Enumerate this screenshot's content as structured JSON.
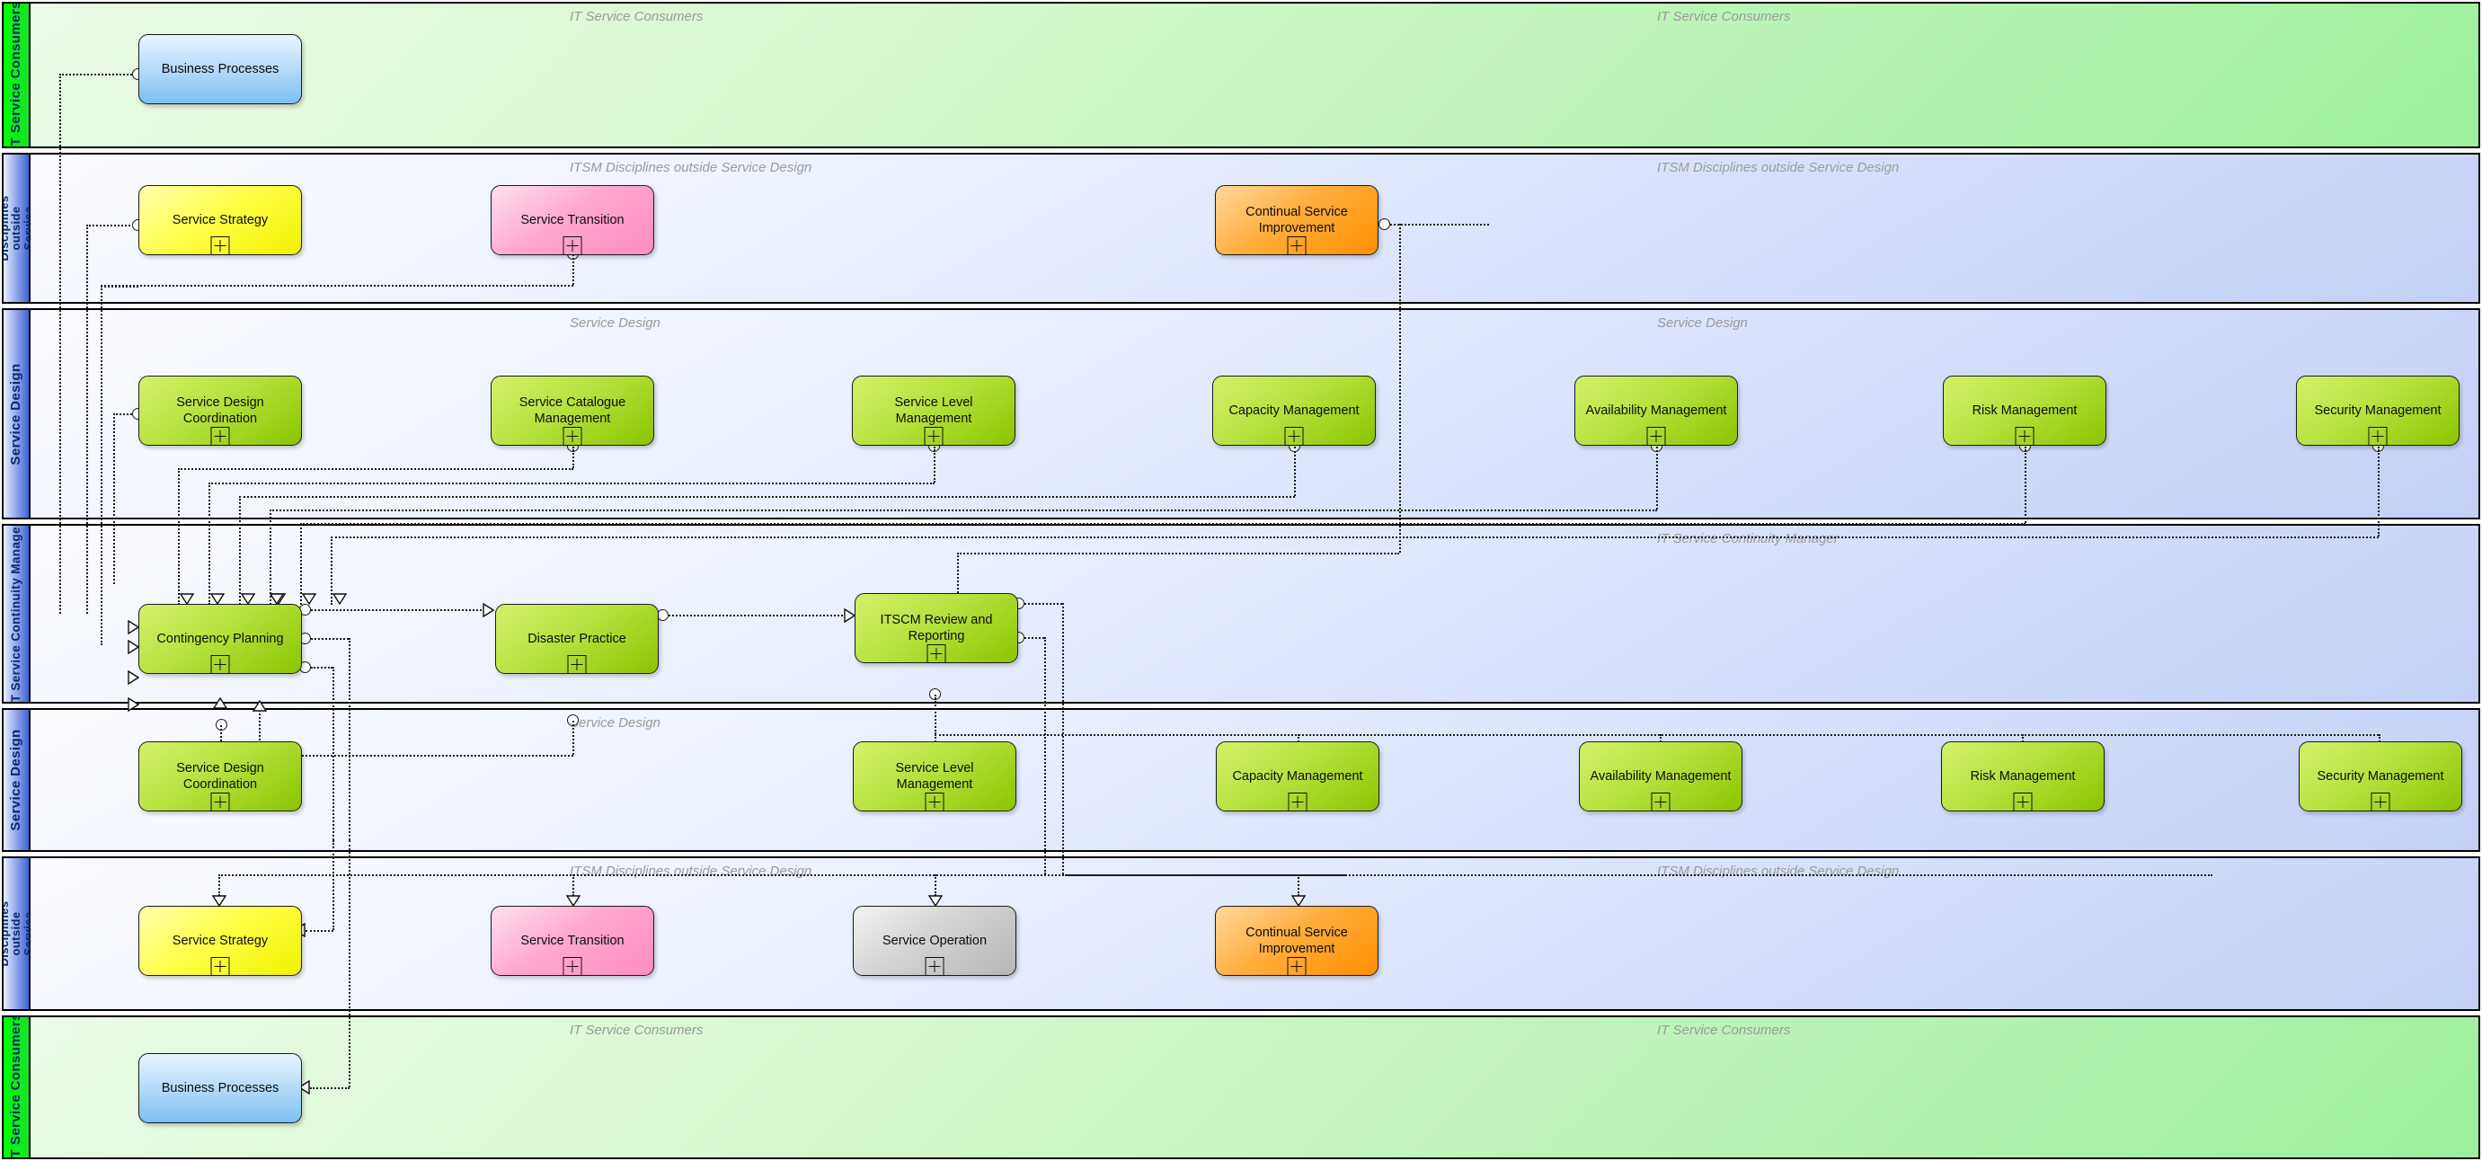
{
  "diagram": {
    "type": "BPMN swimlane collaboration diagram",
    "subject": "IT Service Continuity Management (ITSCM) process interfaces"
  },
  "lanes": [
    {
      "id": "lane1",
      "label": "IT Service Consumers",
      "title_left": "IT Service Consumers",
      "title_right": "IT Service Consumers",
      "palette": "green"
    },
    {
      "id": "lane2",
      "label": "ITSM Disciplines outside\nService Design",
      "title_left": "ITSM Disciplines outside Service Design",
      "title_right": "ITSM Disciplines outside Service Design",
      "palette": "blue"
    },
    {
      "id": "lane3",
      "label": "Service Design",
      "title_left": "Service Design",
      "title_right": "Service Design",
      "palette": "blue"
    },
    {
      "id": "lane4",
      "label": "IT Service Continuity Manager",
      "title_left": "",
      "title_right": "IT Service Continuity Manager",
      "palette": "blue"
    },
    {
      "id": "lane5",
      "label": "Service Design",
      "title_left": "Service Design",
      "title_right": "",
      "palette": "blue"
    },
    {
      "id": "lane6",
      "label": "ITSM Disciplines outside\nService Design",
      "title_left": "ITSM Disciplines outside Service Design",
      "title_right": "ITSM Disciplines outside Service Design",
      "palette": "blue"
    },
    {
      "id": "lane7",
      "label": "IT Service Consumers",
      "title_left": "IT Service Consumers",
      "title_right": "IT Service Consumers",
      "palette": "green"
    }
  ],
  "nodes": {
    "business_processes_top": {
      "label": "Business Processes",
      "color": "#7cc0f2",
      "marker": "none"
    },
    "service_strategy_top": {
      "label": "Service Strategy",
      "color": "#ffff4a",
      "marker": "subprocess"
    },
    "service_transition_top": {
      "label": "Service Transition",
      "color": "#ff8dc0",
      "marker": "subprocess"
    },
    "csi_top": {
      "label": "Continual Service\nImprovement",
      "color": "#ff8f00",
      "marker": "subprocess"
    },
    "sdc_top": {
      "label": "Service Design\nCoordination",
      "color": "#8cc400",
      "marker": "subprocess"
    },
    "scm_top": {
      "label": "Service Catalogue\nManagement",
      "color": "#8cc400",
      "marker": "subprocess"
    },
    "slm_top": {
      "label": "Service Level Management",
      "color": "#8cc400",
      "marker": "subprocess"
    },
    "capm_top": {
      "label": "Capacity Management",
      "color": "#8cc400",
      "marker": "subprocess"
    },
    "avm_top": {
      "label": "Availability Management",
      "color": "#8cc400",
      "marker": "subprocess"
    },
    "rm_top": {
      "label": "Risk Management",
      "color": "#8cc400",
      "marker": "subprocess"
    },
    "secm_top": {
      "label": "Security Management",
      "color": "#8cc400",
      "marker": "subprocess"
    },
    "contingency_planning": {
      "label": "Contingency Planning",
      "color": "#8cc400",
      "marker": "subprocess"
    },
    "disaster_practice": {
      "label": "Disaster Practice",
      "color": "#8cc400",
      "marker": "subprocess"
    },
    "itscm_review": {
      "label": "ITSCM Review and Reporting",
      "color": "#8cc400",
      "marker": "subprocess"
    },
    "sdc_bot": {
      "label": "Service Design\nCoordination",
      "color": "#8cc400",
      "marker": "subprocess"
    },
    "slm_bot": {
      "label": "Service Level Management",
      "color": "#8cc400",
      "marker": "subprocess"
    },
    "capm_bot": {
      "label": "Capacity Management",
      "color": "#8cc400",
      "marker": "subprocess"
    },
    "avm_bot": {
      "label": "Availability Management",
      "color": "#8cc400",
      "marker": "subprocess"
    },
    "rm_bot": {
      "label": "Risk Management",
      "color": "#8cc400",
      "marker": "subprocess"
    },
    "secm_bot": {
      "label": "Security Management",
      "color": "#8cc400",
      "marker": "subprocess"
    },
    "service_strategy_bot": {
      "label": "Service Strategy",
      "color": "#ffff4a",
      "marker": "subprocess"
    },
    "service_transition_bot": {
      "label": "Service Transition",
      "color": "#ff8dc0",
      "marker": "subprocess"
    },
    "service_operation_bot": {
      "label": "Service Operation",
      "color": "#b6b6b6",
      "marker": "subprocess"
    },
    "csi_bot": {
      "label": "Continual Service\nImprovement",
      "color": "#ff8f00",
      "marker": "subprocess"
    },
    "business_processes_bot": {
      "label": "Business Processes",
      "color": "#7cc0f2",
      "marker": "none"
    }
  },
  "colors": {
    "lane_header_green": "#00ff00",
    "lane_header_blue": "#3e63d6",
    "lane_body_green": "#9cf09b",
    "lane_body_blue": "#c3d0f6",
    "node_green": "#8cc400",
    "node_yellow": "#ffff4a",
    "node_pink": "#ff8dc0",
    "node_orange": "#ff8f00",
    "node_blue": "#7cc0f2",
    "node_gray": "#b6b6b6",
    "connector": "#1c1c1c",
    "band_title_text": "#9a9a9a",
    "lane_label_text": "#0b2a6b"
  }
}
